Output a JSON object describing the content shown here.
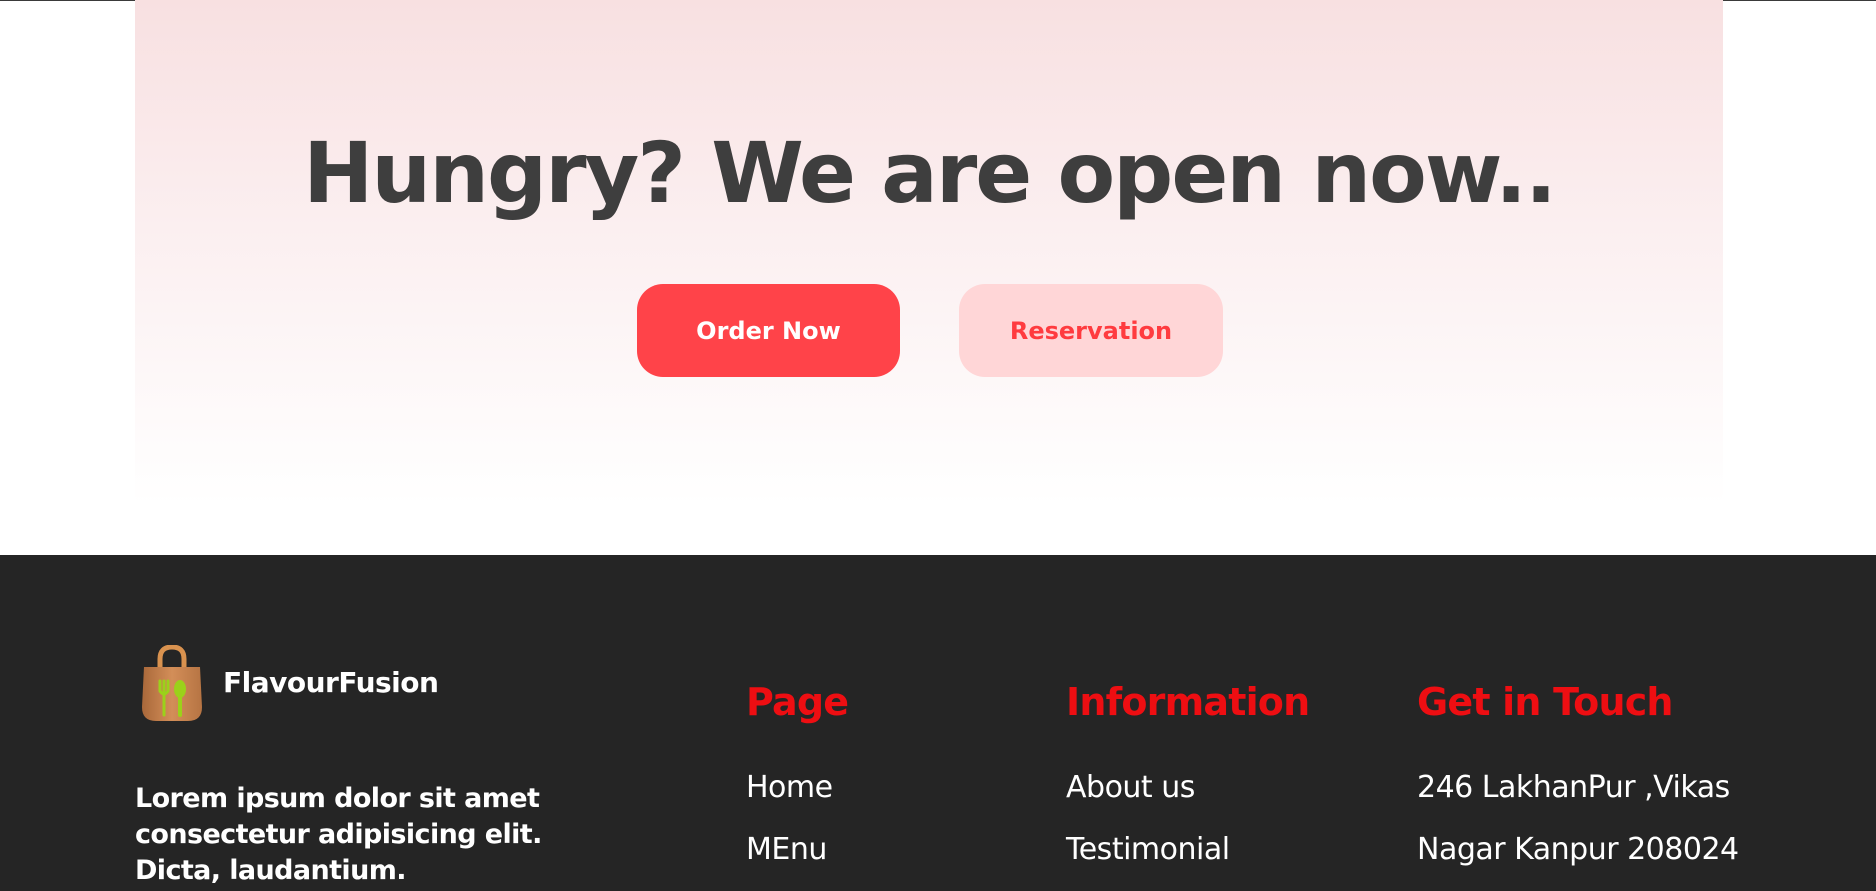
{
  "hero": {
    "title": "Hungry? We are open now..",
    "order_button": "Order Now",
    "reservation_button": "Reservation"
  },
  "footer": {
    "brand": "FlavourFusion",
    "logo_icon": "shopping-bag-fork-spoon-icon",
    "tagline": "Lorem ipsum dolor sit amet consectetur adipisicing elit. Dicta, laudantium.",
    "columns": [
      {
        "heading": "Page",
        "items": [
          "Home",
          "MEnu"
        ]
      },
      {
        "heading": "Information",
        "items": [
          "About us",
          "Testimonial"
        ]
      },
      {
        "heading": "Get in Touch",
        "items": [
          "246 LakhanPur ,Vikas",
          "Nagar Kanpur 208024"
        ]
      }
    ]
  },
  "colors": {
    "accent": "#ff4349",
    "accent_soft": "#ffd6d7",
    "heading_red": "#ee0e12",
    "footer_bg": "#252525",
    "title_text": "#3e3e3e"
  }
}
